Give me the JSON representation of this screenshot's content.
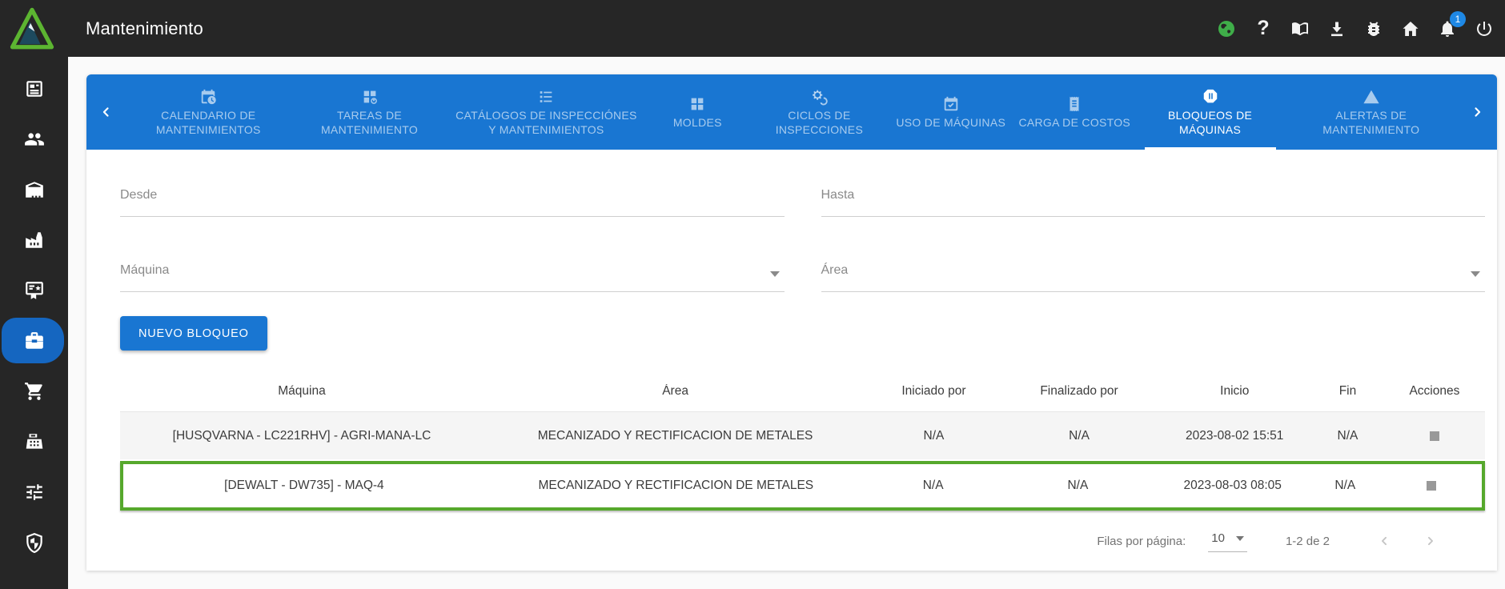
{
  "topbar": {
    "title": "Mantenimiento",
    "notification_badge": "1",
    "icons": [
      "globe-icon",
      "help-icon",
      "book-icon",
      "download-icon",
      "bug-icon",
      "home-icon",
      "bell-icon",
      "power-icon"
    ]
  },
  "sidebar": {
    "items": [
      {
        "icon": "news-icon",
        "active": false
      },
      {
        "icon": "users-icon",
        "active": false
      },
      {
        "icon": "warehouse-icon",
        "active": false
      },
      {
        "icon": "factory-icon",
        "active": false
      },
      {
        "icon": "certificate-icon",
        "active": false
      },
      {
        "icon": "toolbox-icon",
        "active": true
      },
      {
        "icon": "cart-icon",
        "active": false
      },
      {
        "icon": "cash-register-icon",
        "active": false
      },
      {
        "icon": "sliders-icon",
        "active": false
      },
      {
        "icon": "shield-icon",
        "active": false
      }
    ]
  },
  "tabs": {
    "items": [
      {
        "label": "CALENDARIO DE MANTENIMIENTOS",
        "icon": "calendar-clock-icon",
        "active": false
      },
      {
        "label": "TAREAS DE MANTENIMIENTO",
        "icon": "grid-gear-icon",
        "active": false
      },
      {
        "label": "CATÁLOGOS DE INSPECCIÓNES Y MANTENIMIENTOS",
        "icon": "list-icon",
        "active": false
      },
      {
        "label": "MOLDES",
        "icon": "grid-icon",
        "active": false
      },
      {
        "label": "CICLOS DE INSPECCIONES",
        "icon": "gears-icon",
        "active": false
      },
      {
        "label": "USO DE MÁQUINAS",
        "icon": "calendar-check-icon",
        "active": false
      },
      {
        "label": "CARGA DE COSTOS",
        "icon": "receipt-icon",
        "active": false
      },
      {
        "label": "BLOQUEOS DE MÁQUINAS",
        "icon": "pause-octagon-icon",
        "active": true
      },
      {
        "label": "ALERTAS DE MANTENIMIENTO",
        "icon": "warning-icon",
        "active": false
      }
    ]
  },
  "filters": {
    "desde_label": "Desde",
    "hasta_label": "Hasta",
    "maquina_label": "Máquina",
    "area_label": "Área"
  },
  "actions": {
    "new_block_label": "NUEVO BLOQUEO"
  },
  "table": {
    "columns": [
      "Máquina",
      "Área",
      "Iniciado por",
      "Finalizado por",
      "Inicio",
      "Fin",
      "Acciones"
    ],
    "rows": [
      {
        "maquina": "[HUSQVARNA - LC221RHV] - AGRI-MANA-LC",
        "area": "MECANIZADO Y RECTIFICACION DE METALES",
        "iniciado_por": "N/A",
        "finalizado_por": "N/A",
        "inicio": "2023-08-02 15:51",
        "fin": "N/A",
        "accion_icon": "stop-square-icon"
      },
      {
        "maquina": "[DEWALT - DW735] - MAQ-4",
        "area": "MECANIZADO Y RECTIFICACION DE METALES",
        "iniciado_por": "N/A",
        "finalizado_por": "N/A",
        "inicio": "2023-08-03 08:05",
        "fin": "N/A",
        "accion_icon": "stop-square-icon",
        "highlighted": true
      }
    ]
  },
  "pagination": {
    "rows_per_page_label": "Filas por página:",
    "rows_per_page_value": "10",
    "range_label": "1-2 de 2"
  },
  "colors": {
    "topbar_bg": "#262626",
    "primary_blue": "#1976d2",
    "pill_blue": "#1566c0",
    "highlight_green": "#56a82c",
    "row_alt": "#f5f5f5",
    "badge_blue": "#1e88e5",
    "globe_green": "#3fae49"
  }
}
